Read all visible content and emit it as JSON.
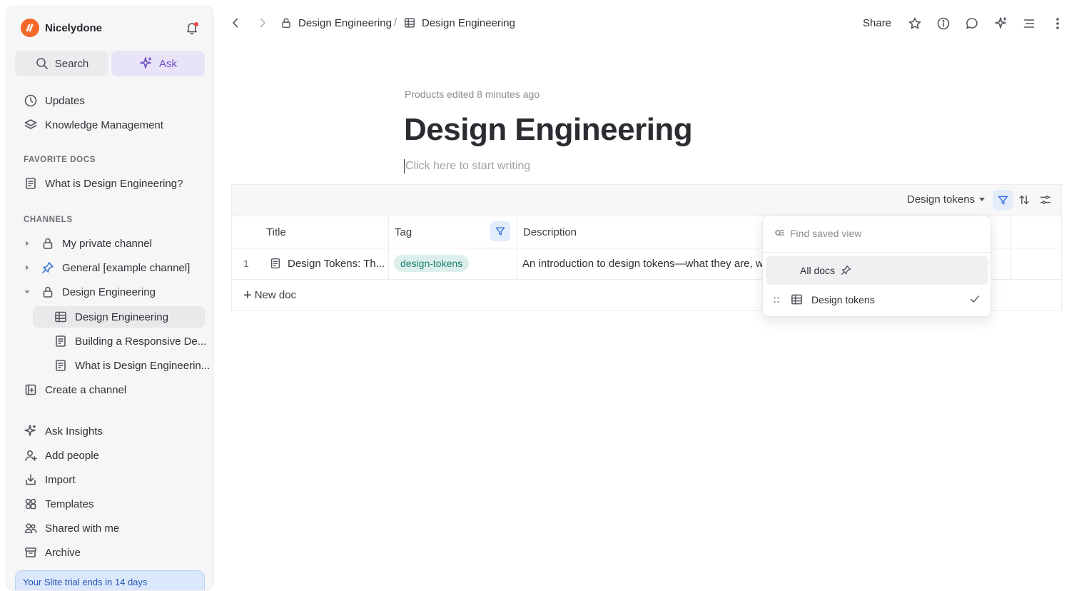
{
  "workspace": {
    "name": "Nicelydone",
    "logo_color": "#f4682a"
  },
  "sidebar": {
    "search_label": "Search",
    "ask_label": "Ask",
    "nav": [
      {
        "label": "Updates",
        "icon": "clock-icon"
      },
      {
        "label": "Knowledge Management",
        "icon": "layers-icon"
      }
    ],
    "favorites_title": "FAVORITE DOCS",
    "favorites": [
      {
        "label": "What is Design Engineering?",
        "icon": "document-icon"
      }
    ],
    "channels_title": "CHANNELS",
    "channels": [
      {
        "label": "My private channel",
        "icon": "lock-icon",
        "expanded": false
      },
      {
        "label": "General [example channel]",
        "icon": "pin-icon",
        "expanded": false
      },
      {
        "label": "Design Engineering",
        "icon": "lock-icon",
        "expanded": true
      }
    ],
    "channel_children": [
      {
        "label": "Design Engineering",
        "icon": "table-icon",
        "selected": true
      },
      {
        "label": "Building a Responsive De...",
        "icon": "document-icon"
      },
      {
        "label": "What is Design Engineerin...",
        "icon": "document-icon"
      }
    ],
    "create_channel": "Create a channel",
    "bottom": [
      {
        "label": "Ask Insights",
        "icon": "sparkle-icon"
      },
      {
        "label": "Add people",
        "icon": "user-plus-icon"
      },
      {
        "label": "Import",
        "icon": "import-icon"
      },
      {
        "label": "Templates",
        "icon": "templates-icon"
      },
      {
        "label": "Shared with me",
        "icon": "users-icon"
      },
      {
        "label": "Archive",
        "icon": "archive-icon"
      }
    ],
    "promo_text": "Your Slite trial ends in 14 days"
  },
  "breadcrumb": {
    "channel": "Design Engineering",
    "separator": "/",
    "page": "Design Engineering"
  },
  "toolbar": {
    "share_label": "Share"
  },
  "doc": {
    "edited_text": "Products edited 8 minutes ago",
    "title": "Design Engineering",
    "placeholder": "Click here to start writing"
  },
  "table": {
    "view_label": "Design tokens",
    "columns": [
      "Title",
      "Tag",
      "Description"
    ],
    "rows": [
      {
        "num": "1",
        "title": "Design Tokens: Th...",
        "tag": "design-tokens",
        "description": "An introduction to design tokens—what they are, why"
      }
    ],
    "new_doc_label": "New doc"
  },
  "saved_views": {
    "search_placeholder": "Find saved view",
    "items": [
      {
        "label": "All docs",
        "pinned": true
      },
      {
        "label": "Design tokens",
        "selected": true
      }
    ]
  },
  "colors": {
    "accent": "#2f6fe0",
    "ask_purple": "#6b4fc8",
    "tag_green": "#1f7f73"
  }
}
